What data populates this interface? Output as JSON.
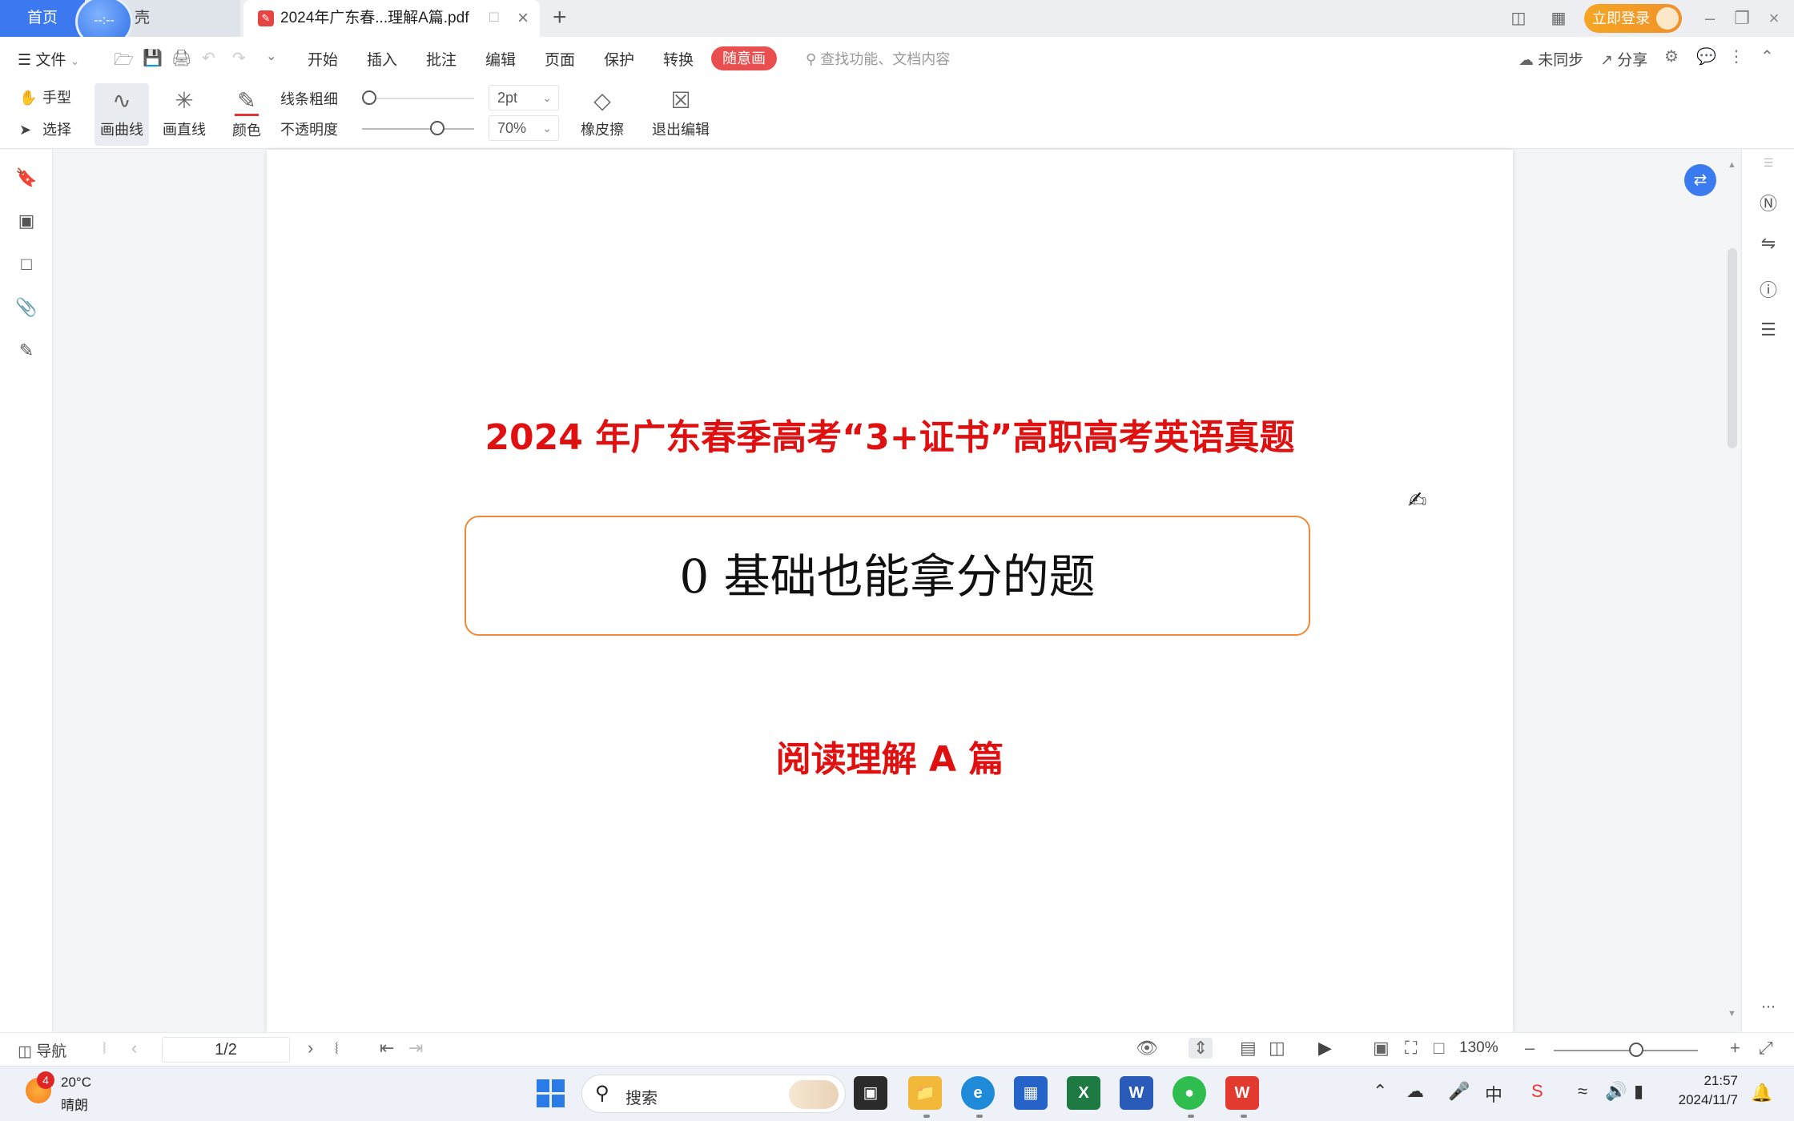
{
  "titlebar": {
    "tab_home": "首页",
    "clock_bubble": "--:--",
    "tab_inactive_suffix": "壳",
    "tab_active": "2024年广东春...理解A篇.pdf",
    "add_tab": "+",
    "login": "立即登录"
  },
  "menubar": {
    "file": "文件",
    "tabs": [
      "开始",
      "插入",
      "批注",
      "编辑",
      "页面",
      "保护",
      "转换"
    ],
    "special_tab": "随意画",
    "search_placeholder": "查找功能、文档内容",
    "sync": "未同步",
    "share": "分享"
  },
  "ribbon": {
    "hand": "手型",
    "select": "选择",
    "curve": "画曲线",
    "line": "画直线",
    "color": "颜色",
    "line_width_label": "线条粗细",
    "opacity_label": "不透明度",
    "line_width_value": "2pt",
    "opacity_value": "70%",
    "opacity_fraction": 0.7,
    "eraser": "橡皮擦",
    "exit_edit": "退出编辑",
    "pen_color": "#e33333"
  },
  "document": {
    "title": "2024 年广东春季高考“3+证书”高职高考英语真题",
    "box_text": "0 基础也能拿分的题",
    "subtitle": "阅读理解 A 篇",
    "title_color": "#e01010",
    "box_border_color": "#f08a3a"
  },
  "statusbar": {
    "nav": "导航",
    "page": "1/2",
    "zoom": "130%"
  },
  "taskbar": {
    "weather_badge": "4",
    "weather_temp": "20°C",
    "weather_desc": "晴朗",
    "search_placeholder": "搜索",
    "time": "21:57",
    "date": "2024/11/7"
  }
}
